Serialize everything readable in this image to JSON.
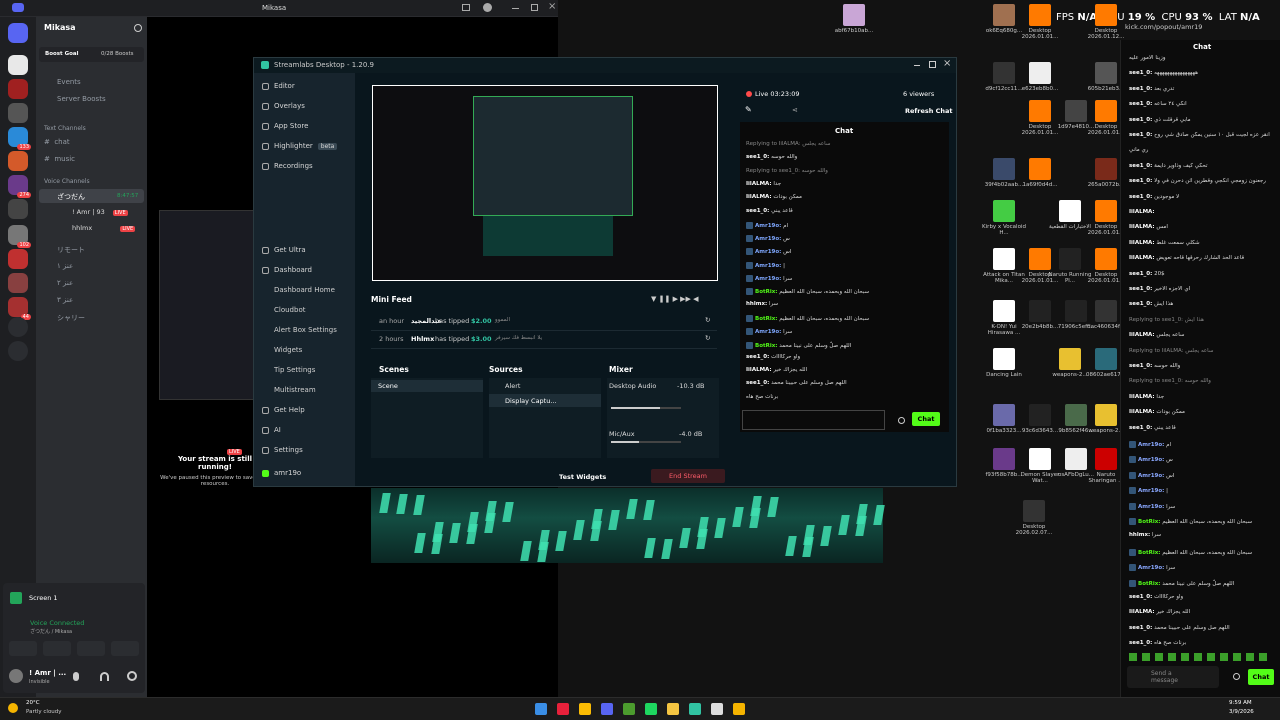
{
  "desktop": {
    "icons": [
      {
        "label": "abf67b10ab...",
        "color": "#c9a6d6"
      },
      {
        "label": "ok6Eq680g...",
        "color": "#a07050"
      },
      {
        "label": "Desktop 2026.01.01...",
        "color": "#ff7a00"
      },
      {
        "label": "Desktop 2026.01.12...",
        "color": "#ff7a00"
      },
      {
        "label": "d9cf12cc11...",
        "color": "#333"
      },
      {
        "label": "e623eb8b0...",
        "color": "#eee"
      },
      {
        "label": "605b21eb3...",
        "color": "#555"
      },
      {
        "label": "Desktop 2026.01.01...",
        "color": "#ff7a00"
      },
      {
        "label": "1d97e4810...",
        "color": "#444"
      },
      {
        "label": "Desktop 2026.01.01...",
        "color": "#ff7a00"
      },
      {
        "label": "39f4b02aab...",
        "color": "#3a4a6a"
      },
      {
        "label": "1a69f0d4d...",
        "color": "#ff7a00"
      },
      {
        "label": "265a0072b...",
        "color": "#7a2a1a"
      },
      {
        "label": "Kirby x Vocaloid H...",
        "color": "#4c4"
      },
      {
        "label": "الاختبارات القطعية",
        "color": "#fff"
      },
      {
        "label": "Desktop 2026.01.01...",
        "color": "#ff7a00"
      },
      {
        "label": "Attack on Titan Mika...",
        "color": "#fff"
      },
      {
        "label": "Desktop 2026.01.01...",
        "color": "#ff7a00"
      },
      {
        "label": "Naruto Running Pl...",
        "color": "#222"
      },
      {
        "label": "Desktop 2026.01.01...",
        "color": "#ff7a00"
      },
      {
        "label": "K-ON! Yui Hirasawa ...",
        "color": "#fff"
      },
      {
        "label": "20e2b4b8b...",
        "color": "#222"
      },
      {
        "label": "71906c5eff...",
        "color": "#222"
      },
      {
        "label": "dac460634f...",
        "color": "#333"
      },
      {
        "label": "Dancing Lain",
        "color": "#fff"
      },
      {
        "label": "weapons-2...",
        "color": "#e8c030"
      },
      {
        "label": "08602ae617...",
        "color": "#2a6a7a"
      },
      {
        "label": "0f1ba3323...",
        "color": "#6a6aaa"
      },
      {
        "label": "93c6d3643...",
        "color": "#222"
      },
      {
        "label": "9b8562f46...",
        "color": "#4a6a4a"
      },
      {
        "label": "weapons-2...",
        "color": "#e8c030"
      },
      {
        "label": "f93f58b78b...",
        "color": "#6a3a8a"
      },
      {
        "label": "Demon Slayer Wat...",
        "color": "#fff"
      },
      {
        "label": "osAFbDgLu...",
        "color": "#eee"
      },
      {
        "label": "Naruto Sharingan ...",
        "color": "#c00"
      },
      {
        "label": "Desktop 2026.02.07...",
        "color": "#333"
      }
    ],
    "overlay": {
      "fps_label": "FPS",
      "fps": "N/A",
      "gpu_label": "GPU",
      "gpu": "19 %",
      "cpu_label": "CPU",
      "cpu": "93 %",
      "lat_label": "LAT",
      "lat": "N/A"
    }
  },
  "discord": {
    "window_title": "Mikasa",
    "server_name": "Mikasa",
    "boost_goal": "Boost Goal",
    "boost_count": "0/28 Boosts",
    "events": "Events",
    "server_boosts": "Server Boosts",
    "text_header": "Text Channels",
    "text_channels": [
      "chat",
      "music"
    ],
    "voice_header": "Voice Channels",
    "voice_main": "ざつだん",
    "voice_time": "8:47:57",
    "voice_users": [
      {
        "name": "! Amr | 93",
        "badge": "LIVE"
      },
      {
        "name": "hhlmx",
        "badge": "LIVE"
      }
    ],
    "other_voice": [
      "リモート",
      "عنز ١",
      "عنز ٢",
      "عنز ٣",
      "シャリー"
    ],
    "server_badges": [
      "",
      "",
      "",
      "",
      "133",
      "",
      "274",
      "",
      "102",
      "",
      "",
      "44"
    ],
    "stream_paused_title": "Your stream is still running!",
    "stream_paused_sub": "We've paused this preview to save your resources.",
    "live_badge": "LIVE",
    "screen_label": "Screen 1",
    "voice_connected": "Voice Connected",
    "voice_sub": "ざつだん / Mikasa",
    "user_name": "! Amr | ...",
    "user_status": "Invisible"
  },
  "streamlabs": {
    "title": "Streamlabs Desktop - 1.20.9",
    "nav": [
      "Editor",
      "Overlays",
      "App Store",
      "Highlighter",
      "Recordings"
    ],
    "beta": "beta",
    "nav2": [
      "Get Ultra",
      "Dashboard"
    ],
    "dashboard_sub": [
      "Dashboard Home",
      "Cloudbot",
      "Alert Box Settings",
      "Widgets",
      "Tip Settings",
      "Multistream"
    ],
    "nav3": [
      "Get Help",
      "AI",
      "Settings"
    ],
    "username": "amr19o",
    "live_time": "Live 03:23:09",
    "viewers": "6 viewers",
    "refresh_chat": "Refresh Chat",
    "chat_title": "Chat",
    "chat_button": "Chat",
    "mini_feed_title": "Mini Feed",
    "feed": [
      {
        "time": "an hour",
        "name": "عبدالمجيد",
        "action": "has tipped",
        "amount": "$2.00",
        "note": "المموو"
      },
      {
        "time": "2 hours",
        "name": "Hhlmx",
        "action": "has tipped",
        "amount": "$3.00",
        "note": "يلا انبسط فك سيرفر"
      }
    ],
    "scenes_title": "Scenes",
    "scene_item": "Scene",
    "sources_title": "Sources",
    "sources": [
      "Alert",
      "Display Captu..."
    ],
    "mixer_title": "Mixer",
    "mixer": [
      {
        "name": "Desktop Audio",
        "db": "-10.3 dB",
        "level": 0.7
      },
      {
        "name": "Mic/Aux",
        "db": "-4.0 dB",
        "level": 0.4
      }
    ],
    "test_widgets": "Test Widgets",
    "end_stream": "End Stream",
    "chat_msgs": [
      {
        "type": "reply",
        "text": "Replying to IilALMA: ساعه يجلس"
      },
      {
        "type": "msg",
        "name": "see1_0:",
        "text": "والله حوسه"
      },
      {
        "type": "reply",
        "text": "Replying to see1_0: والله حوسه"
      },
      {
        "type": "msg",
        "name": "IilALMA:",
        "text": "جدا"
      },
      {
        "type": "msg",
        "name": "IilALMA:",
        "text": "ممكن بودات"
      },
      {
        "type": "msg",
        "name": "see1_0:",
        "text": "قاعد يبني"
      },
      {
        "type": "user",
        "name": "Amr19o:",
        "text": "ام"
      },
      {
        "type": "user",
        "name": "Amr19o:",
        "text": "س"
      },
      {
        "type": "user",
        "name": "Amr19o:",
        "text": "اس"
      },
      {
        "type": "user",
        "name": "Amr19o:",
        "text": "|"
      },
      {
        "type": "user",
        "name": "Amr19o:",
        "text": "سرا"
      },
      {
        "type": "bot",
        "name": "BotRix:",
        "text": "سبحان الله وبحمده، سبحان الله العظيم"
      },
      {
        "type": "msg",
        "name": "hhlmx:",
        "text": "سرا"
      },
      {
        "type": "bot",
        "name": "BotRix:",
        "text": "سبحان الله وبحمده، سبحان الله العظيم"
      },
      {
        "type": "user",
        "name": "Amr19o:",
        "text": "سرا"
      },
      {
        "type": "bot",
        "name": "BotRix:",
        "text": "اللهم صلّ وسلم على نبينا محمد"
      },
      {
        "type": "msg",
        "name": "see1_0:",
        "text": "واو حركاااات"
      },
      {
        "type": "msg",
        "name": "IilALMA:",
        "text": "الله يجزاك خير"
      },
      {
        "type": "msg",
        "name": "see1_0:",
        "text": "اللهم صل وسلم على حبيبنا محمد"
      },
      {
        "type": "msg",
        "name": "",
        "text": "برنات صح هاه"
      }
    ]
  },
  "popout": {
    "url": "kick.com/popout/amr19",
    "title": "Chat",
    "send_placeholder": "Send a message",
    "chat_button": "Chat",
    "msgs": [
      {
        "type": "plain",
        "text": "وزينا الامور عليه"
      },
      {
        "type": "msg",
        "name": "see1_0:",
        "text": "ههههههههههههههههه"
      },
      {
        "type": "msg",
        "name": "see1_0:",
        "text": "تدري بعد"
      },
      {
        "type": "msg",
        "name": "see1_0:",
        "text": "انكي ٢٤ ساعه"
      },
      {
        "type": "msg",
        "name": "see1_0:",
        "text": "مابي قرقلت ذي"
      },
      {
        "type": "msg",
        "name": "see1_0:",
        "text": "انقر عزه لجيت قبل ١٠ سنين يمكن صادق شي روح"
      },
      {
        "type": "plain",
        "text": "ري ماني"
      },
      {
        "type": "msg",
        "name": "see1_0:",
        "text": "تحكي كيف وذاوير دايمة"
      },
      {
        "type": "msg",
        "name": "see1_0:",
        "text": "رجعنون زومجي انكجي وقطرين اثن دحرن في ولا"
      },
      {
        "type": "msg",
        "name": "see1_0:",
        "text": "لا موجودين"
      },
      {
        "type": "msg",
        "name": "IilALMA:",
        "text": ""
      },
      {
        "type": "msg",
        "name": "IilALMA:",
        "text": "امس"
      },
      {
        "type": "msg",
        "name": "IilALMA:",
        "text": "شكلي سمعت غلط"
      },
      {
        "type": "msg",
        "name": "IilALMA:",
        "text": "قاعد الحد الشارك رحرقها قاحه تعويض"
      },
      {
        "type": "msg",
        "name": "see1_0:",
        "text": "20$"
      },
      {
        "type": "msg",
        "name": "see1_0:",
        "text": "اي الاجزه الاخير"
      },
      {
        "type": "msg",
        "name": "see1_0:",
        "text": "هذا ايش"
      },
      {
        "type": "reply",
        "text": "Replying to see1_0: هذا ايش"
      },
      {
        "type": "msg",
        "name": "IilALMA:",
        "text": "ساعه يجلس"
      },
      {
        "type": "reply",
        "text": "Replying to IilALMA: ساعه يجلس"
      },
      {
        "type": "msg",
        "name": "see1_0:",
        "text": "والله حوسه"
      },
      {
        "type": "reply",
        "text": "Replying to see1_0: والله حوسه"
      },
      {
        "type": "msg",
        "name": "IilALMA:",
        "text": "جدا"
      },
      {
        "type": "msg",
        "name": "IilALMA:",
        "text": "ممكن بودات"
      },
      {
        "type": "msg",
        "name": "see1_0:",
        "text": "قاعد يبني"
      },
      {
        "type": "user",
        "name": "Amr19o:",
        "text": "ام"
      },
      {
        "type": "user",
        "name": "Amr19o:",
        "text": "س"
      },
      {
        "type": "user",
        "name": "Amr19o:",
        "text": "اس"
      },
      {
        "type": "user",
        "name": "Amr19o:",
        "text": "|"
      },
      {
        "type": "user",
        "name": "Amr19o:",
        "text": "سرا"
      },
      {
        "type": "bot",
        "name": "BotRix:",
        "text": "سبحان الله وبحمده، سبحان الله العظيم"
      },
      {
        "type": "msg",
        "name": "hhlmx:",
        "text": "سرا"
      },
      {
        "type": "bot",
        "name": "BotRix:",
        "text": "سبحان الله وبحمده، سبحان الله العظيم"
      },
      {
        "type": "user",
        "name": "Amr19o:",
        "text": "سرا"
      },
      {
        "type": "bot",
        "name": "BotRix:",
        "text": "اللهم صلّ وسلم على نبينا محمد"
      },
      {
        "type": "msg",
        "name": "see1_0:",
        "text": "واو حركاااات"
      },
      {
        "type": "msg",
        "name": "IilALMA:",
        "text": "الله يجزاك خير"
      },
      {
        "type": "msg",
        "name": "see1_0:",
        "text": "اللهم صل وسلم على حبيبنا محمد"
      },
      {
        "type": "msg",
        "name": "see1_0:",
        "text": "برنات صح هاه"
      }
    ]
  },
  "taskbar": {
    "weather_temp": "20°C",
    "weather_desc": "Partly cloudy",
    "time": "9:59 AM",
    "date": "3/9/2026",
    "apps": [
      "windows-icon",
      "opera-icon",
      "chrome-icon",
      "discord-icon",
      "minecraft-icon",
      "spotify-icon",
      "files-icon",
      "streamlabs-icon",
      "capcut-icon",
      "app-icon"
    ],
    "colors": {
      "accent": "#53fc18",
      "live": "#ed4245",
      "kick": "#53fc18"
    }
  }
}
